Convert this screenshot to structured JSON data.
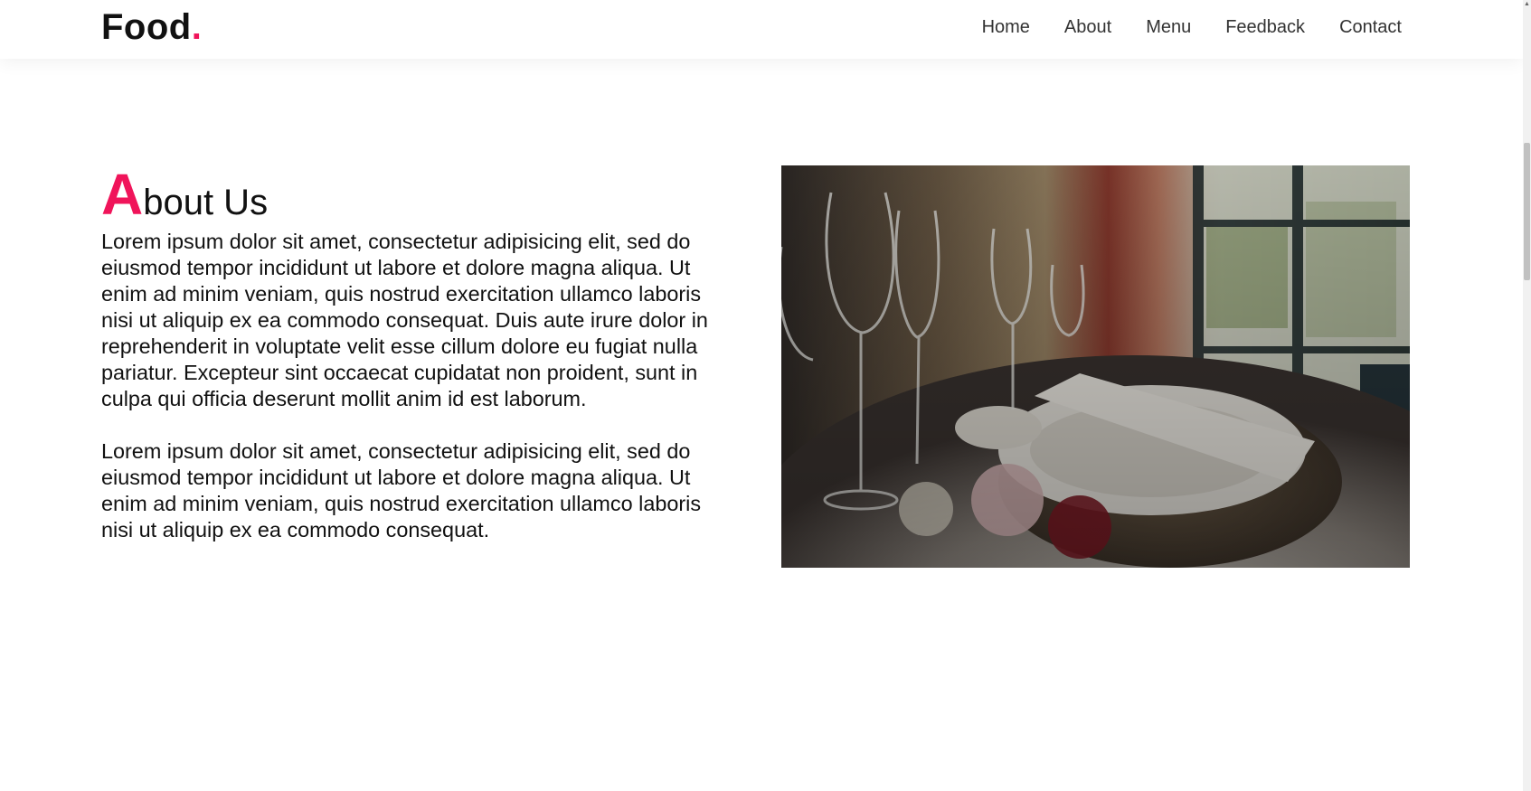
{
  "header": {
    "brand_name": "Food",
    "brand_dot": ".",
    "brand_accent_color": "#f0145a",
    "nav": [
      {
        "label": "Home"
      },
      {
        "label": "About"
      },
      {
        "label": "Menu"
      },
      {
        "label": "Feedback"
      },
      {
        "label": "Contact"
      }
    ]
  },
  "about": {
    "title_initial": "A",
    "title_rest": "bout Us",
    "paragraphs": [
      "Lorem ipsum dolor sit amet, consectetur adipisicing elit, sed do eiusmod tempor incididunt ut labore et dolore magna aliqua. Ut enim ad minim veniam, quis nostrud exercitation ullamco laboris nisi ut aliquip ex ea commodo consequat. Duis aute irure dolor in reprehenderit in voluptate velit esse cillum dolore eu fugiat nulla pariatur. Excepteur sint occaecat cupidatat non proident, sunt in culpa qui officia deserunt mollit anim id est laborum.",
      "Lorem ipsum dolor sit amet, consectetur adipisicing elit, sed do eiusmod tempor incididunt ut labore et dolore magna aliqua. Ut enim ad minim veniam, quis nostrud exercitation ullamco laboris nisi ut aliquip ex ea commodo consequat."
    ],
    "image_subject": "restaurant-table-setting"
  },
  "scrollbar": {
    "arrow": "▲"
  }
}
